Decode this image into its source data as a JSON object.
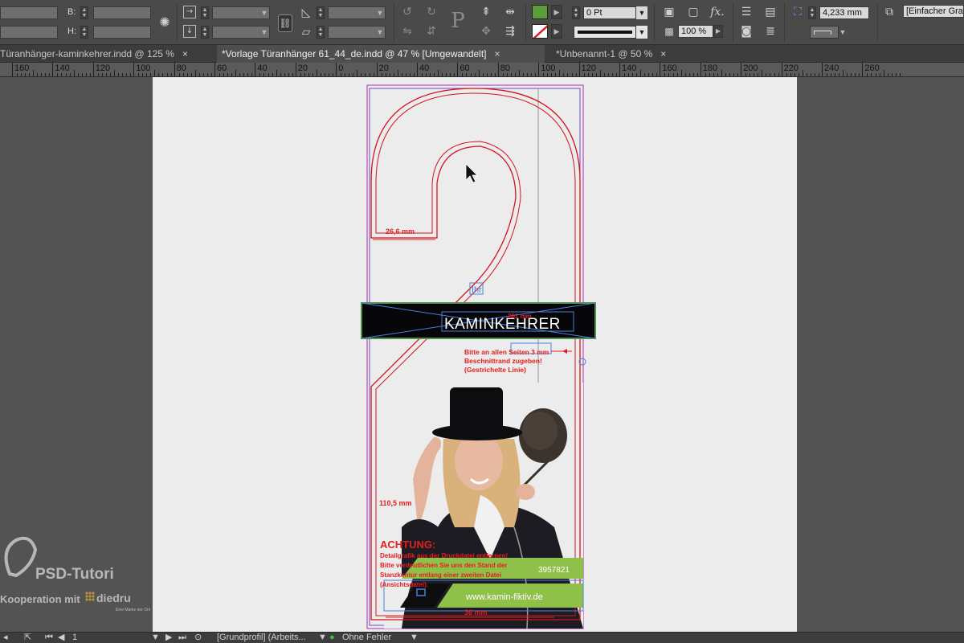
{
  "control_panel": {
    "width_label": "B:",
    "height_label": "H:",
    "stroke_weight": "0 Pt",
    "opacity": "100 %",
    "dimension_value": "4,233 mm",
    "object_style": "[Einfacher Grafikrahmen]",
    "colors": {
      "fill": "#5c9e3a",
      "stroke_none": "#ffffff",
      "accent": "#c81e1e"
    }
  },
  "tabs": [
    {
      "label": "Türanhänger-kaminkehrer.indd @ 125 %",
      "active": false
    },
    {
      "label": "*Vorlage Türanhänger 61_44_de.indd @ 47 % [Umgewandelt]",
      "active": true
    },
    {
      "label": "*Unbenannt-1 @ 50 %",
      "active": false
    }
  ],
  "tab_close_symbol": "×",
  "ruler": {
    "labels": [
      "160",
      "140",
      "120",
      "100",
      "80",
      "60",
      "40",
      "20",
      "0",
      "20",
      "40",
      "60",
      "80",
      "100",
      "120",
      "140",
      "160",
      "180",
      "200",
      "220",
      "240",
      "260"
    ]
  },
  "artwork": {
    "text_frame_label": "Ihr",
    "banner_text": "KAMINKEHRER",
    "dim_top": "26,6 mm",
    "dim_side": "110,5 mm",
    "dim_bottom": "36 mm",
    "dim_banner": "261 mm",
    "note_lines": [
      "Bitte an allen Seiten 3 mm",
      "Beschnittrand zugeben!",
      "(Gestrichelte Linie)"
    ],
    "warning_title": "ACHTUNG:",
    "warning_lines": [
      "Detailgrafik aus der Druckdatei entfernen!",
      "Bitte verdeutlichen Sie uns den Stand der",
      "Stanzkontur entlang einer zweiten Datei",
      "(Ansichtsdatei)."
    ],
    "phone_fragment": "3957821",
    "website": "www.kamin-fiktiv.de"
  },
  "status_bar": {
    "page_number": "1",
    "profile": "[Grundprofil] (Arbeits...",
    "preflight": "Ohne Fehler"
  },
  "watermark": {
    "brand": "PSD-Tutori",
    "cooperation": "Kooperation mit",
    "partner": "diedru",
    "partner_sub": "Eine Marke der Onl"
  }
}
